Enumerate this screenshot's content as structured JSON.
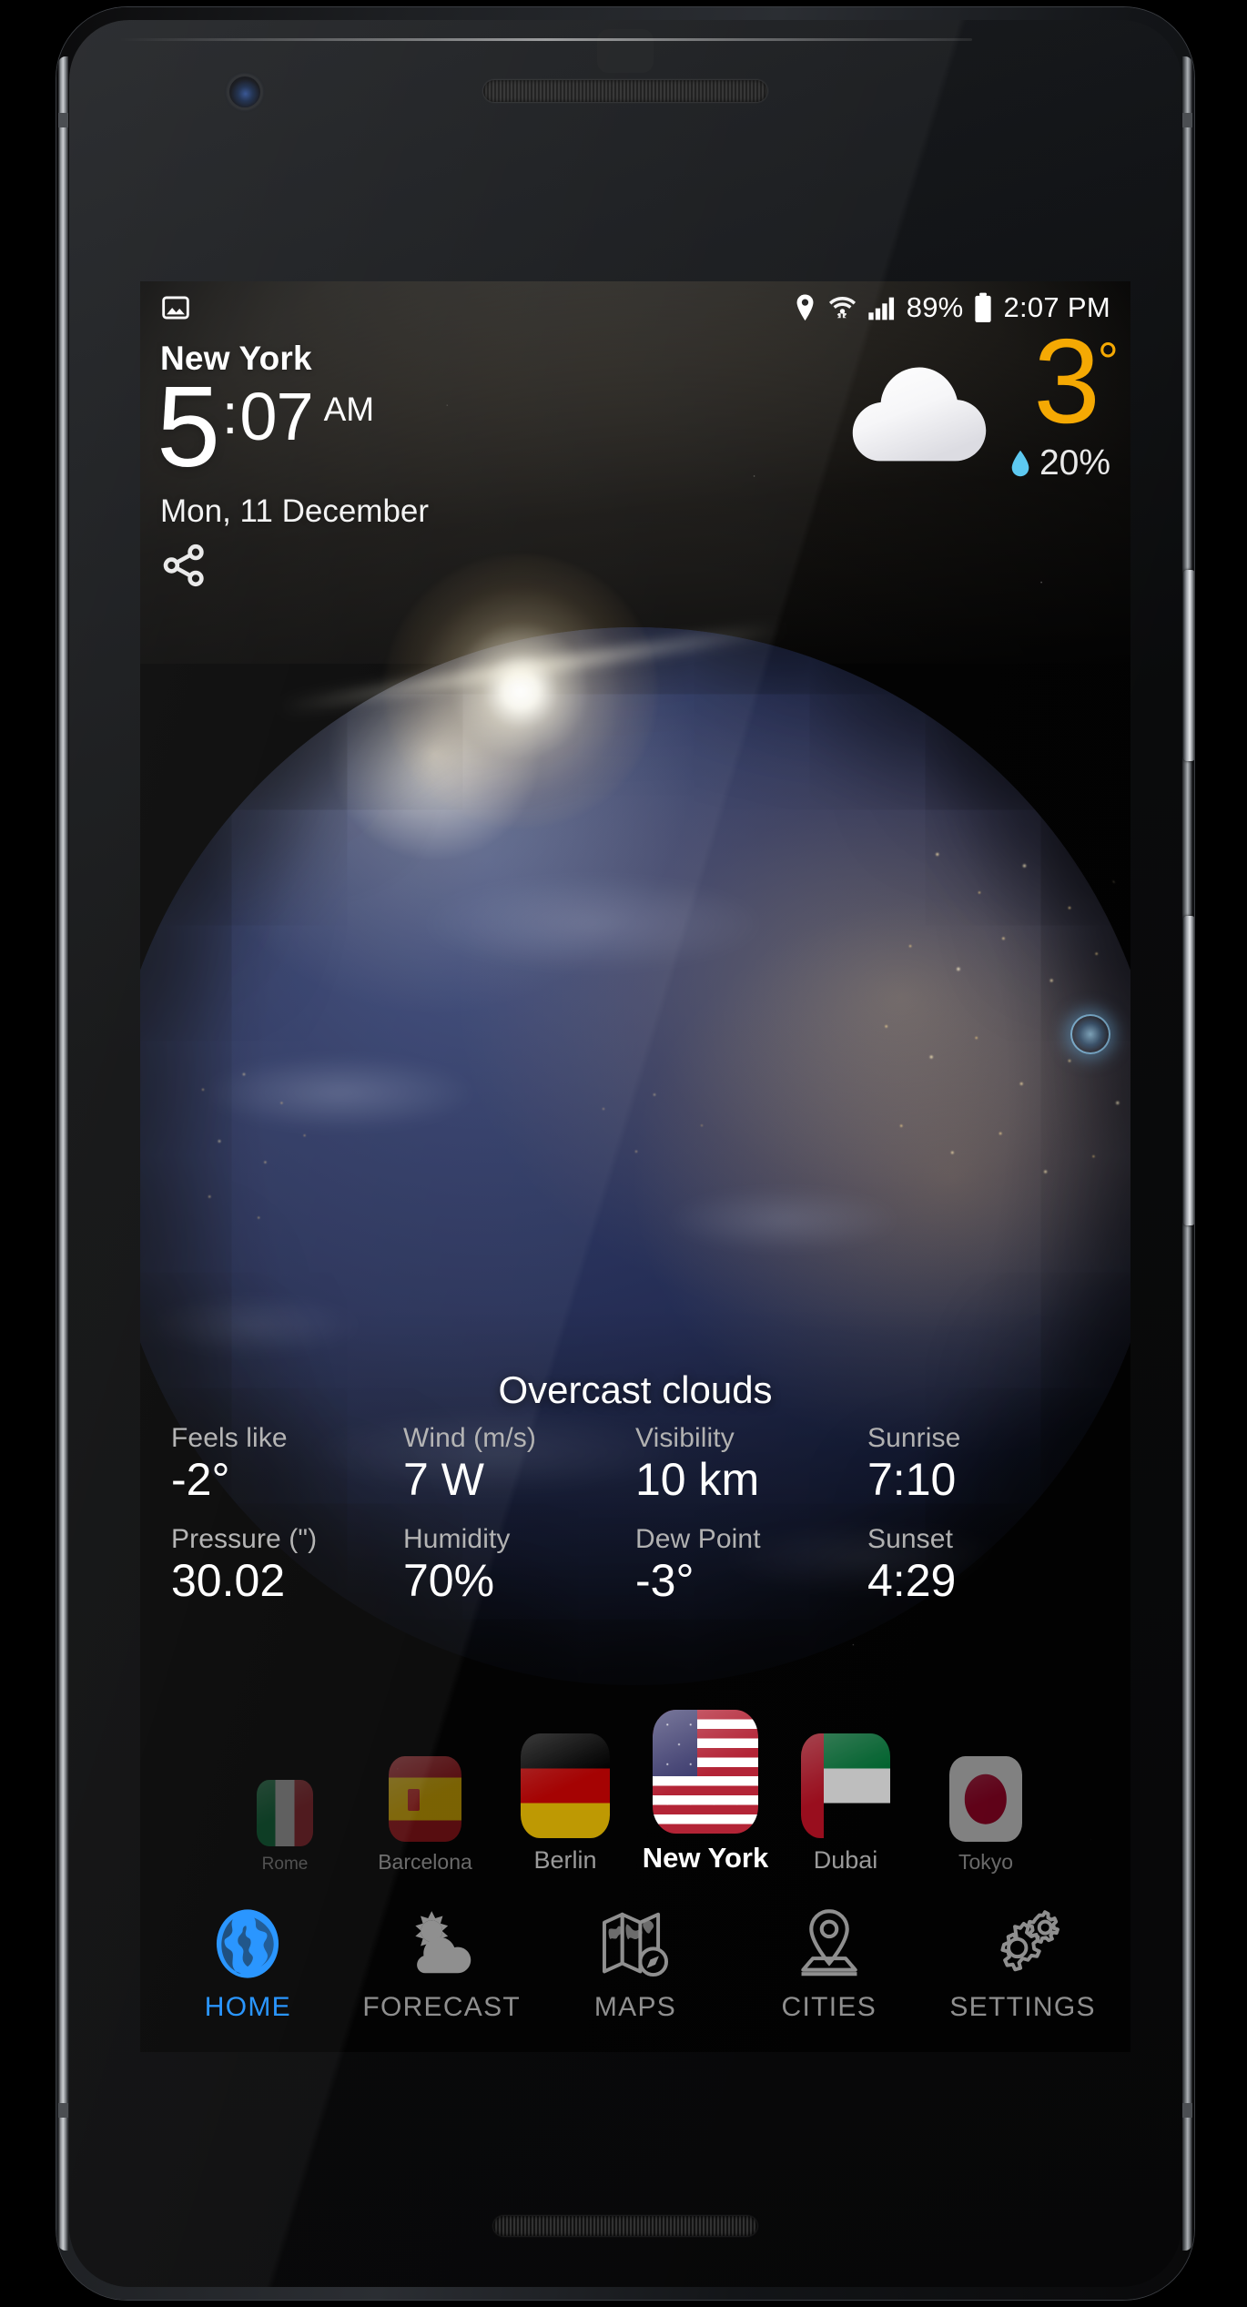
{
  "device": {
    "hardware": {
      "earpiece": "earpiece-speaker",
      "front_camera": "front-camera",
      "bottom_speaker": "bottom-speaker",
      "volume_button": "volume-button",
      "power_button": "power-button"
    }
  },
  "status_bar": {
    "notification_icon": "image-icon",
    "location_icon": "location-pin-icon",
    "wifi_icon": "wifi-icon",
    "signal_icon": "cellular-signal-icon",
    "battery_percent": "89%",
    "battery_icon": "battery-icon",
    "clock": "2:07 PM"
  },
  "header": {
    "city": "New York",
    "clock_hour": "5",
    "clock_colon": ":",
    "clock_minute": "07",
    "clock_ampm": "AM",
    "date": "Mon, 11 December",
    "share_icon": "share-icon"
  },
  "current_weather": {
    "icon": "overcast-cloud-icon",
    "temperature": "3",
    "degree_symbol": "°",
    "temp_color": "#F5A800",
    "precip_icon": "water-drop-icon",
    "precip_color": "#5BC8F0",
    "precipitation": "20%",
    "condition": "Overcast clouds"
  },
  "details": [
    {
      "label": "Feels like",
      "value": "-2°"
    },
    {
      "label": "Wind (m/s)",
      "value": "7 W"
    },
    {
      "label": "Visibility",
      "value": "10 km"
    },
    {
      "label": "Sunrise",
      "value": "7:10"
    },
    {
      "label": "Pressure (\")",
      "value": "30.02"
    },
    {
      "label": "Humidity",
      "value": "70%"
    },
    {
      "label": "Dew Point",
      "value": "-3°"
    },
    {
      "label": "Sunset",
      "value": "4:29"
    }
  ],
  "cities": [
    {
      "name": "Rome",
      "flag": "italy-flag",
      "selected": false
    },
    {
      "name": "Barcelona",
      "flag": "spain-flag",
      "selected": false
    },
    {
      "name": "Berlin",
      "flag": "germany-flag",
      "selected": false
    },
    {
      "name": "New York",
      "flag": "usa-flag",
      "selected": true
    },
    {
      "name": "Dubai",
      "flag": "uae-flag",
      "selected": false
    },
    {
      "name": "Tokyo",
      "flag": "japan-flag",
      "selected": false
    }
  ],
  "bottom_nav": {
    "active_color": "#1E90FF",
    "items": [
      {
        "label": "HOME",
        "icon": "globe-icon",
        "active": true
      },
      {
        "label": "FORECAST",
        "icon": "sun-cloud-icon",
        "active": false
      },
      {
        "label": "MAPS",
        "icon": "map-icon",
        "active": false
      },
      {
        "label": "CITIES",
        "icon": "map-pin-icon",
        "active": false
      },
      {
        "label": "SETTINGS",
        "icon": "gears-icon",
        "active": false
      }
    ]
  },
  "globe": {
    "location_marker": "globe-location-marker"
  }
}
